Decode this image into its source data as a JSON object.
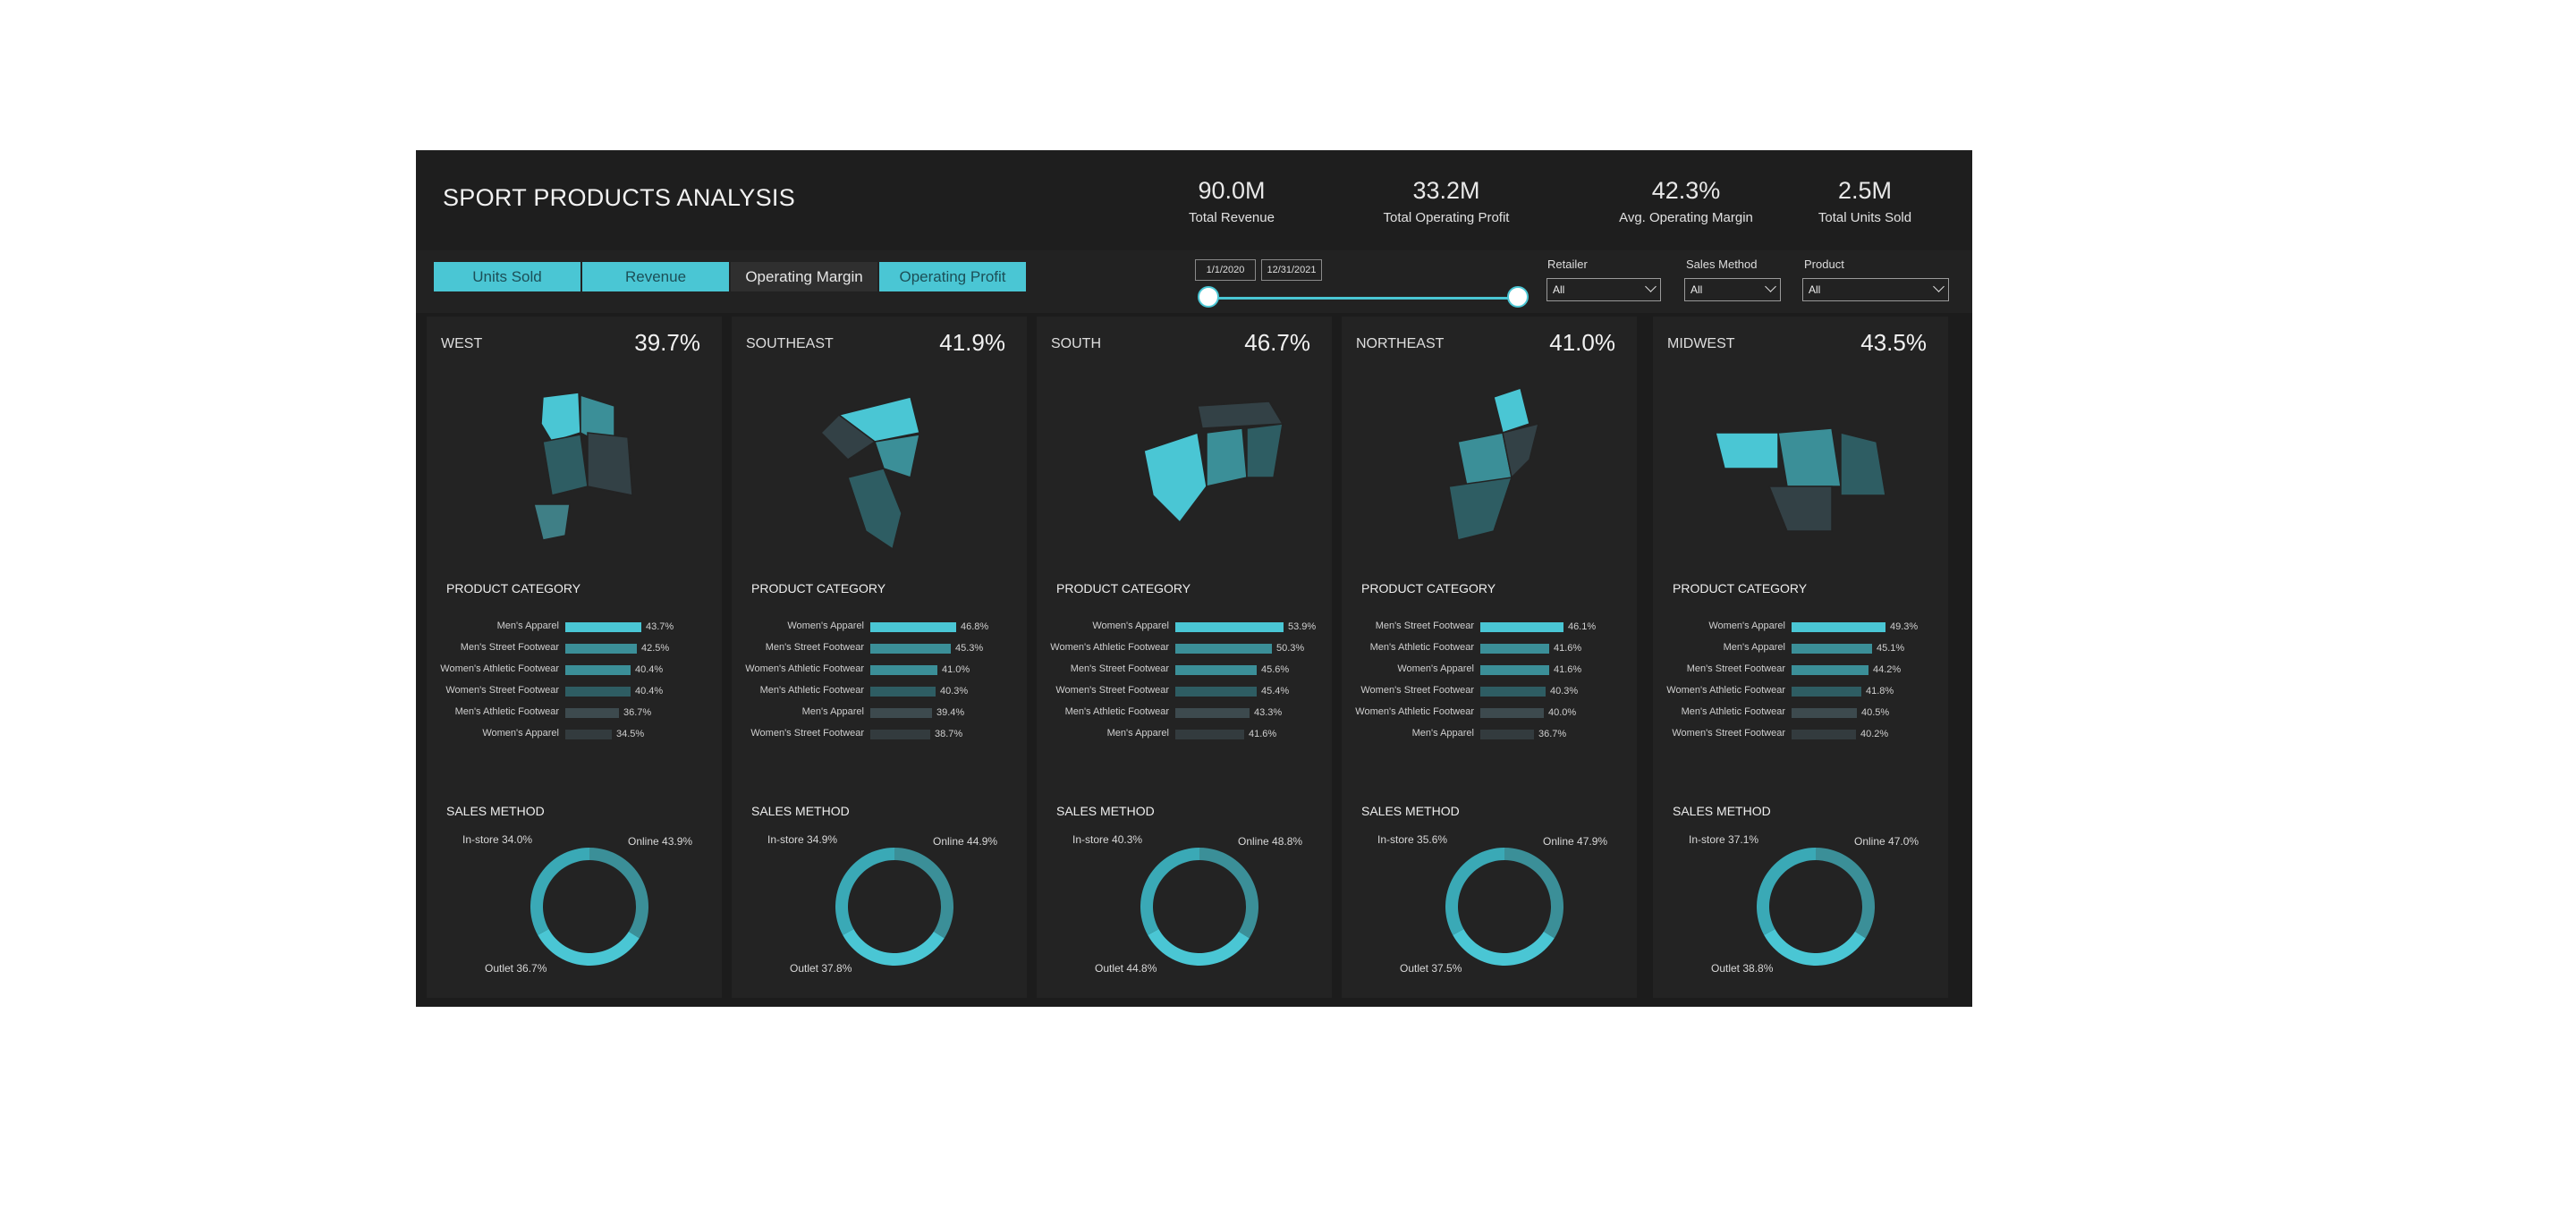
{
  "title": "SPORT PRODUCTS ANALYSIS",
  "kpis": [
    {
      "value": "90.0M",
      "label": "Total Revenue"
    },
    {
      "value": "33.2M",
      "label": "Total Operating Profit"
    },
    {
      "value": "42.3%",
      "label": "Avg. Operating Margin"
    },
    {
      "value": "2.5M",
      "label": "Total Units Sold"
    }
  ],
  "toggles": [
    {
      "label": "Units Sold",
      "active": false
    },
    {
      "label": "Revenue",
      "active": false
    },
    {
      "label": "Operating Margin",
      "active": true
    },
    {
      "label": "Operating Profit",
      "active": false
    }
  ],
  "date_range": {
    "start": "1/1/2020",
    "end": "12/31/2021"
  },
  "filters": [
    {
      "label": "Retailer",
      "value": "All"
    },
    {
      "label": "Sales Method",
      "value": "All"
    },
    {
      "label": "Product",
      "value": "All"
    }
  ],
  "colors": {
    "accent": "#4ac6d4",
    "mid": "#3b8f98",
    "dark": "#2e5d63",
    "darker": "#334146",
    "panel": "#232323"
  },
  "section_titles": {
    "category": "PRODUCT CATEGORY",
    "sales": "SALES METHOD"
  },
  "regions": [
    {
      "name": "WEST",
      "margin": "39.7%",
      "map_icon": "west-us-map-icon",
      "categories": [
        {
          "label": "Men's Apparel",
          "value": 43.7
        },
        {
          "label": "Men's Street Footwear",
          "value": 42.5
        },
        {
          "label": "Women's Athletic Footwear",
          "value": 40.4
        },
        {
          "label": "Women's Street Footwear",
          "value": 40.4
        },
        {
          "label": "Men's Athletic Footwear",
          "value": 36.7
        },
        {
          "label": "Women's Apparel",
          "value": 34.5
        }
      ],
      "sales": {
        "online": "Online 43.9%",
        "instore": "In-store 34.0%",
        "outlet": "Outlet 36.7%"
      }
    },
    {
      "name": "SOUTHEAST",
      "margin": "41.9%",
      "map_icon": "southeast-us-map-icon",
      "categories": [
        {
          "label": "Women's Apparel",
          "value": 46.8
        },
        {
          "label": "Men's Street Footwear",
          "value": 45.3
        },
        {
          "label": "Women's Athletic Footwear",
          "value": 41.0
        },
        {
          "label": "Men's Athletic Footwear",
          "value": 40.3
        },
        {
          "label": "Men's Apparel",
          "value": 39.4
        },
        {
          "label": "Women's Street Footwear",
          "value": 38.7
        }
      ],
      "sales": {
        "online": "Online 44.9%",
        "instore": "In-store 34.9%",
        "outlet": "Outlet 37.8%"
      }
    },
    {
      "name": "SOUTH",
      "margin": "46.7%",
      "map_icon": "south-us-map-icon",
      "categories": [
        {
          "label": "Women's Apparel",
          "value": 53.9
        },
        {
          "label": "Women's Athletic Footwear",
          "value": 50.3
        },
        {
          "label": "Men's Street Footwear",
          "value": 45.6
        },
        {
          "label": "Women's Street Footwear",
          "value": 45.4
        },
        {
          "label": "Men's Athletic Footwear",
          "value": 43.3
        },
        {
          "label": "Men's Apparel",
          "value": 41.6
        }
      ],
      "sales": {
        "online": "Online 48.8%",
        "instore": "In-store 40.3%",
        "outlet": "Outlet 44.8%"
      }
    },
    {
      "name": "NORTHEAST",
      "margin": "41.0%",
      "map_icon": "northeast-us-map-icon",
      "categories": [
        {
          "label": "Men's Street Footwear",
          "value": 46.1
        },
        {
          "label": "Men's Athletic Footwear",
          "value": 41.6
        },
        {
          "label": "Women's Apparel",
          "value": 41.6
        },
        {
          "label": "Women's Street Footwear",
          "value": 40.3
        },
        {
          "label": "Women's Athletic Footwear",
          "value": 40.0
        },
        {
          "label": "Men's Apparel",
          "value": 36.7
        }
      ],
      "sales": {
        "online": "Online 47.9%",
        "instore": "In-store 35.6%",
        "outlet": "Outlet 37.5%"
      }
    },
    {
      "name": "MIDWEST",
      "margin": "43.5%",
      "map_icon": "midwest-us-map-icon",
      "categories": [
        {
          "label": "Women's Apparel",
          "value": 49.3
        },
        {
          "label": "Men's Apparel",
          "value": 45.1
        },
        {
          "label": "Men's Street Footwear",
          "value": 44.2
        },
        {
          "label": "Women's Athletic Footwear",
          "value": 41.8
        },
        {
          "label": "Men's Athletic Footwear",
          "value": 40.5
        },
        {
          "label": "Women's Street Footwear",
          "value": 40.2
        }
      ],
      "sales": {
        "online": "Online 47.0%",
        "instore": "In-store 37.1%",
        "outlet": "Outlet 38.8%"
      }
    }
  ]
}
